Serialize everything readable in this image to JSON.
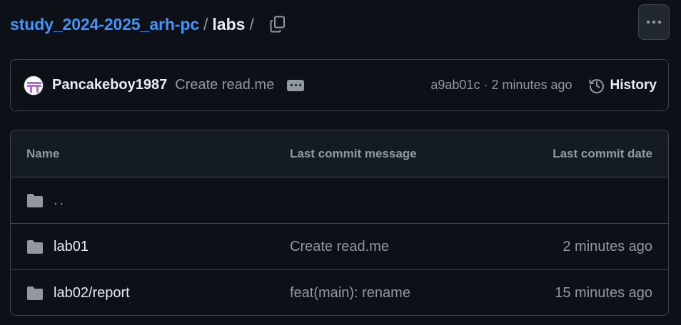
{
  "breadcrumb": {
    "repo": "study_2024-2025_arh-pc",
    "separator": "/",
    "current": "labs",
    "trailing_separator": "/",
    "copy_icon": "copy-icon"
  },
  "header_actions": {
    "more_icon": "kebab-horizontal-icon"
  },
  "latest_commit": {
    "author": "Pancakeboy1987",
    "message": "Create read.me",
    "hash": "a9ab01c",
    "dot": "·",
    "time": "2 minutes ago",
    "history_label": "History"
  },
  "table": {
    "headers": {
      "name": "Name",
      "message": "Last commit message",
      "date": "Last commit date"
    },
    "parent_link": "..",
    "rows": [
      {
        "name": "lab01",
        "message": "Create read.me",
        "date": "2 minutes ago",
        "icon": "folder-icon"
      },
      {
        "name": "lab02/report",
        "message": "feat(main): rename",
        "date": "15 minutes ago",
        "icon": "folder-icon"
      }
    ]
  },
  "colors": {
    "background": "#0d1117",
    "header_background": "#151b23",
    "border": "#3d444d",
    "link": "#4493f8",
    "text_primary": "#e6edf3",
    "text_muted": "#9198a1",
    "folder": "#9198a1"
  }
}
